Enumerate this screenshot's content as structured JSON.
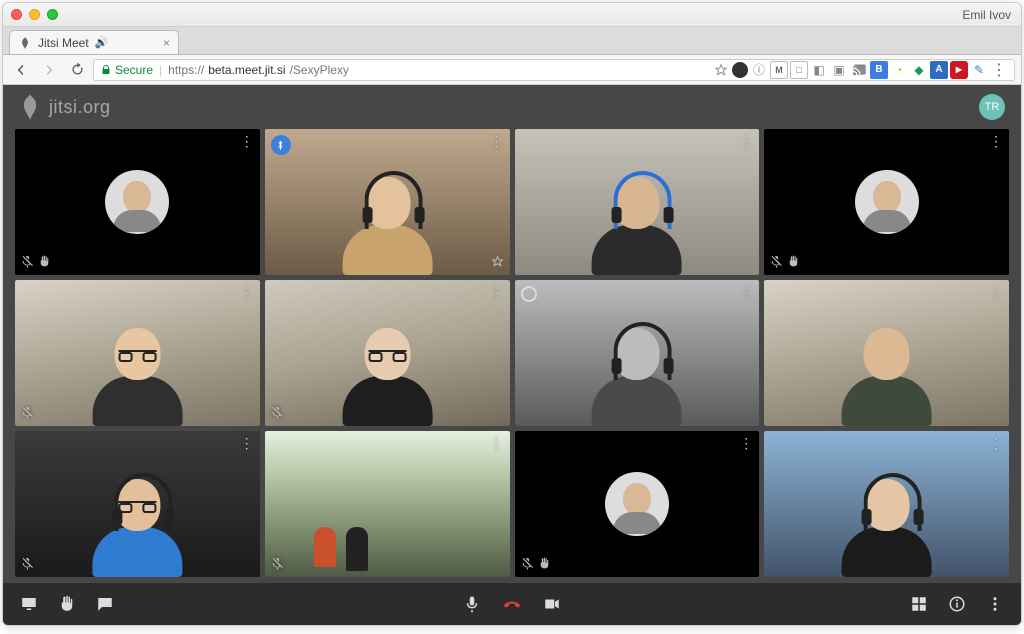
{
  "os": {
    "profile_name": "Emil Ivov"
  },
  "browser": {
    "tab": {
      "title": "Jitsi Meet",
      "favicon": "jitsi-icon"
    },
    "nav": {
      "back_enabled": true,
      "forward_enabled": false
    },
    "secure_label": "Secure",
    "url_scheme": "https://",
    "url_host": "beta.meet.jit.si",
    "url_path": "/SexyPlexy"
  },
  "app": {
    "logo_text": "jitsi.org",
    "local_user_initials": "TR",
    "active_speaker_index": 1,
    "tiles": [
      {
        "id": 0,
        "camera_on": false,
        "avatar": true,
        "mic_muted": true,
        "raised_hand": true,
        "menu": true
      },
      {
        "id": 1,
        "camera_on": true,
        "pinned": true,
        "starred": true,
        "menu": true,
        "bg": "vf-room1",
        "skin": "#e5c29e",
        "torso": "#c9a36d",
        "headset": true
      },
      {
        "id": 2,
        "camera_on": true,
        "menu": true,
        "bg": "vf-room2",
        "skin": "#d8b691",
        "torso": "#2b2b2b",
        "headset": true,
        "headset_color": "#2a6fd6"
      },
      {
        "id": 3,
        "camera_on": false,
        "avatar": true,
        "mic_muted": true,
        "raised_hand": true,
        "menu": true
      },
      {
        "id": 4,
        "camera_on": true,
        "mic_muted": true,
        "menu": true,
        "bg": "vf-office",
        "skin": "#e7c6a1",
        "torso": "#2f2f2f",
        "headset": false,
        "glasses": true
      },
      {
        "id": 5,
        "camera_on": true,
        "mic_muted": true,
        "menu": true,
        "bg": "vf-office2",
        "skin": "#e7cbae",
        "torso": "#1e1e1e",
        "headset": false,
        "glasses": true
      },
      {
        "id": 6,
        "camera_on": true,
        "dominant": true,
        "menu": true,
        "bg": "vf-bw",
        "skin": "#bcbcbc",
        "torso": "#4a4a4a",
        "headset": true
      },
      {
        "id": 7,
        "camera_on": true,
        "menu": true,
        "bg": "vf-office",
        "skin": "#dcb893",
        "torso": "#3f4a3c",
        "headset": false
      },
      {
        "id": 8,
        "camera_on": true,
        "mic_muted": true,
        "menu": true,
        "bg": "vf-dark",
        "narrow": true,
        "skin": "#e4c09a",
        "torso": "#2f7bd1",
        "headset": true,
        "glasses": true
      },
      {
        "id": 9,
        "camera_on": true,
        "mic_muted": true,
        "menu": true,
        "bg": "vf-window",
        "skin": "#dcb48a",
        "torso": "#d65b2b",
        "wide_scene": true
      },
      {
        "id": 10,
        "camera_on": false,
        "avatar": true,
        "mic_muted": true,
        "raised_hand": true,
        "menu": true
      },
      {
        "id": 11,
        "camera_on": true,
        "menu": true,
        "bg": "vf-blue",
        "skin": "#e6c6a5",
        "torso": "#1b1b1b",
        "headset": true
      }
    ],
    "toolbox": {
      "left": [
        "screen-share-icon",
        "raise-hand-icon",
        "chat-icon"
      ],
      "center": [
        "mic-icon",
        "hangup-icon",
        "camera-icon"
      ],
      "right": [
        "tile-view-icon",
        "info-icon",
        "more-icon"
      ]
    }
  }
}
